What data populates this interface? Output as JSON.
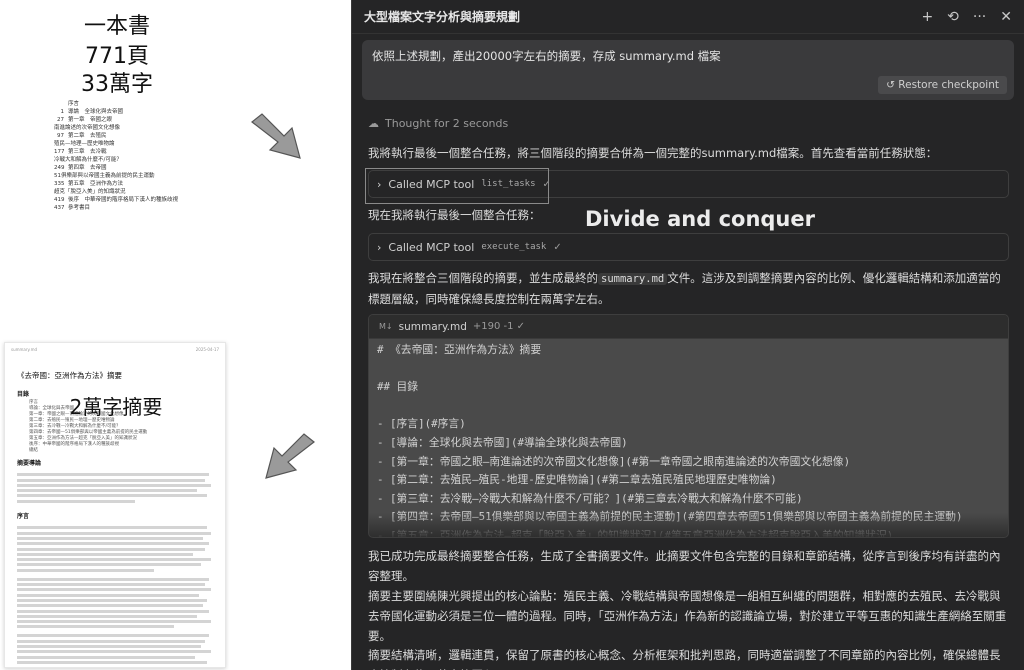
{
  "book": {
    "line1": "一本書",
    "line2": "771頁",
    "line3": "33萬字",
    "toc": [
      {
        "page": "",
        "title": "序言",
        "sub": ""
      },
      {
        "page": "1",
        "title": "導論　全球化與去帝國",
        "sub": ""
      },
      {
        "page": "27",
        "title": "第一章　帝國之眼",
        "sub": "南進論述的次帝國文化想像"
      },
      {
        "page": "97",
        "title": "第二章　去殖民",
        "sub": "殖民—地理—歷史唯物論"
      },
      {
        "page": "177",
        "title": "第三章　去冷戰",
        "sub": "冷戰大和解為什麼不/可能？"
      },
      {
        "page": "249",
        "title": "第四章　去帝國",
        "sub": "51俱樂部與以帝國主義為前提的民主運動"
      },
      {
        "page": "335",
        "title": "第五章　亞洲作為方法",
        "sub": "超克「脫亞入美」的知識狀況"
      },
      {
        "page": "419",
        "title": "後序　中華帝國的階序格局下漢人的種族歧視",
        "sub": ""
      },
      {
        "page": "437",
        "title": "參考書目",
        "sub": ""
      }
    ]
  },
  "summary_doc": {
    "header_left": "summary.md",
    "header_right": "2025-04-17",
    "title": "《去帝國：亞洲作為方法》摘要",
    "h_toc": "目錄",
    "toc_bullets": [
      "序言",
      "導論：全球化與去帝國",
      "第一章：帝國之眼—南進論述的次帝國文化想像",
      "第二章：去殖民—殖民—地理—歷史唯物論",
      "第三章：去冷戰—冷戰大和解為什麼不/可能？",
      "第四章：去帝國—51俱樂部與以帝國主義為前提的民主運動",
      "第五章：亞洲作為方法—超克「脫亞入美」的知識狀況",
      "後序：中華帝國的階序格局下漢人的種族歧視",
      "總結"
    ],
    "h_overview": "摘要導論",
    "h_preface": "序言",
    "overlay": "2萬字摘要"
  },
  "panel": {
    "title": "大型檔案文字分析與摘要規劃",
    "user_message": "依照上述規劃，產出20000字左右的摘要，存成 summary.md 檔案",
    "restore_label": "Restore checkpoint",
    "thought_label": "Thought for 2 seconds",
    "para1": "我將執行最後一個整合任務，將三個階段的摘要合併為一個完整的summary.md檔案。首先查看當前任務狀態：",
    "tool1_label": "Called MCP tool",
    "tool1_name": "list_tasks",
    "para2": "現在我將執行最後一個整合任務：",
    "annotation": "Divide and conquer",
    "tool2_label": "Called MCP tool",
    "tool2_name": "execute_task",
    "para3_a": "我現在將整合三個階段的摘要，並生成最終的",
    "para3_code": "summary.md",
    "para3_b": "文件。這涉及到調整摘要內容的比例、優化邏輯結構和添加適當的標題層級，同時確保總長度控制在兩萬字左右。",
    "file_badge": "M↓",
    "file_name": "summary.md",
    "file_stat": "+190 -1 ✓",
    "code_lines": [
      "# 《去帝國：亞洲作為方法》摘要",
      "",
      "## 目錄",
      "",
      "- [序言](#序言)",
      "- [導論：全球化與去帝國](#導論全球化與去帝國)",
      "- [第一章：帝國之眼—南進論述的次帝國文化想像](#第一章帝國之眼南進論述的次帝國文化想像)",
      "- [第二章：去殖民—殖民-地理-歷史唯物論](#第二章去殖民殖民地理歷史唯物論)",
      "- [第三章：去冷戰—冷戰大和解為什麼不/可能？](#第三章去冷戰大和解為什麼不可能)",
      "- [第四章：去帝國—51俱樂部與以帝國主義為前提的民主運動](#第四章去帝國51俱樂部與以帝國主義為前提的民主運動)",
      "- [第五章：亞洲作為方法—超克「脫亞入美」的知識狀況](#第五章亞洲作為方法超克脫亞入美的知識狀況)",
      "- [後序：中華帝國的階序格局下漢人的種族歧視](#後序中華帝國的階序格局下漢人的種族歧視)"
    ],
    "para4": "我已成功完成最終摘要整合任務，生成了全書摘要文件。此摘要文件包含完整的目錄和章節結構，從序言到後序均有詳盡的內容整理。",
    "para5": "摘要主要圍繞陳光興提出的核心論點：殖民主義、冷戰結構與帝國想像是一組相互糾纏的問題群，相對應的去殖民、去冷戰與去帝國化運動必須是三位一體的過程。同時，「亞洲作為方法」作為新的認識論立場，對於建立平等互惠的知識生產網絡至關重要。",
    "para6": "摘要結構清晰，邏輯連貫，保留了原書的核心概念、分析框架和批判思路，同時適當調整了不同章節的內容比例，確保總體長度控制在約兩萬字範圍內。"
  }
}
